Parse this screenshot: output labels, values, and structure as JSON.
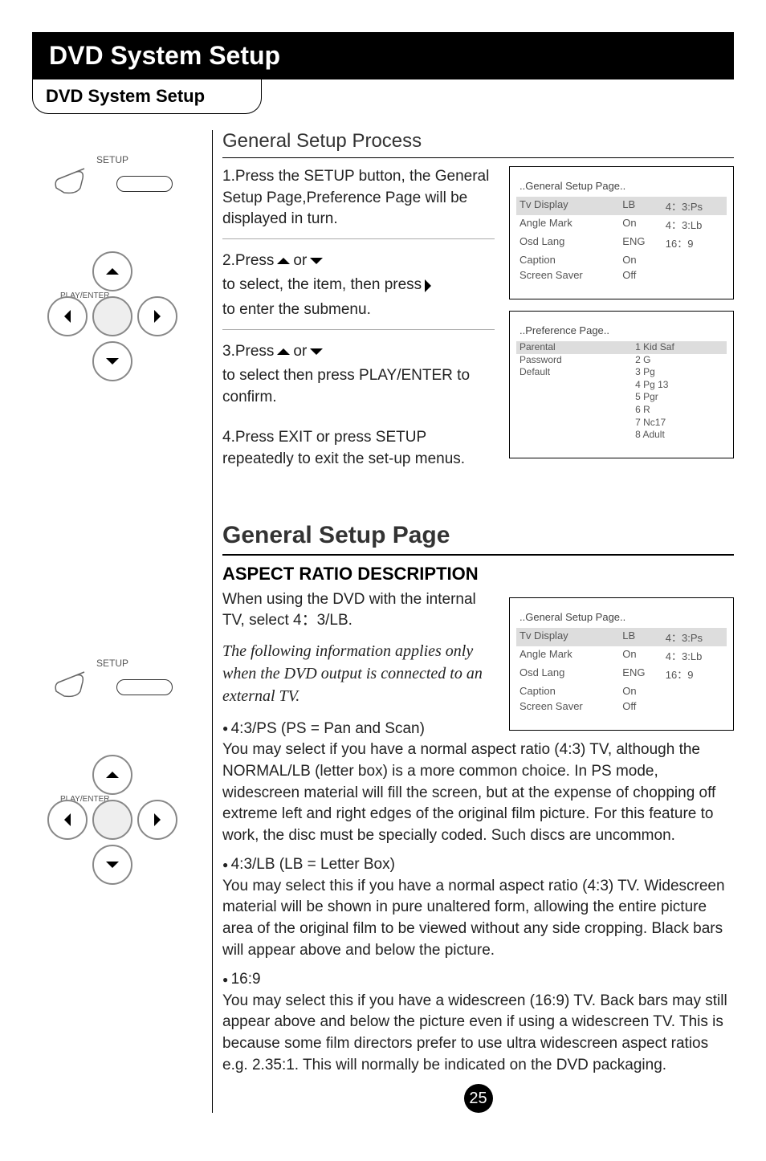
{
  "title_bar": "DVD System Setup",
  "subtitle": "DVD System Setup",
  "left": {
    "setup_label": "SETUP",
    "dpad_label": "PLAY/ENTER"
  },
  "process": {
    "heading": "General Setup Process",
    "step1": "1.Press the SETUP button, the General Setup Page,Preference Page  will be displayed in turn.",
    "step2a": "2.Press ",
    "step2b": " or ",
    "step2c": "   to select, the item, then press ",
    "step2d": " to enter the submenu.",
    "step3a": "3.Press ",
    "step3b": " or ",
    "step3c": "  to select  then press PLAY/ENTER to confirm.",
    "step4": "4.Press EXIT or press SETUP repeatedly to exit the set-up menus."
  },
  "osd1": {
    "title": "..General Setup Page..",
    "rows": [
      [
        "Tv Display",
        "LB",
        "4：3:Ps"
      ],
      [
        "Angle Mark",
        "On",
        "4：3:Lb"
      ],
      [
        "Osd Lang",
        "ENG",
        "16：9"
      ],
      [
        "Caption",
        "On",
        ""
      ],
      [
        "Screen Saver",
        "Off",
        ""
      ]
    ]
  },
  "osd2": {
    "title": "..Preference Page..",
    "left_items": [
      "Parental",
      "Password",
      "Default"
    ],
    "right_items": [
      "1 Kid Saf",
      "2 G",
      "3 Pg",
      "4 Pg 13",
      "5 Pgr",
      "6 R",
      "7 Nc17",
      "8 Adult"
    ]
  },
  "general_page": {
    "heading": "General Setup Page",
    "sub": "ASPECT RATIO DESCRIPTION",
    "intro": "When using the DVD with the internal TV, select 4：3/LB.",
    "note": "The following information applies only when the DVD output is connected to an external TV.",
    "ps": {
      "lbl": "4:3/PS (PS = Pan and Scan)",
      "txt": "You may select if you have a normal aspect ratio (4:3) TV, although the NORMAL/LB (letter box) is a more common choice. In PS mode, widescreen material will fill the screen, but at the expense of chopping off extreme left and right edges of the original film picture. For this feature to work, the disc must be specially coded. Such discs are uncommon."
    },
    "lb": {
      "lbl": "4:3/LB (LB = Letter Box)",
      "txt": "You may select this if you have a normal aspect ratio (4:3) TV. Widescreen material will be shown in pure unaltered form, allowing the entire picture area of the original film to be viewed without any side cropping. Black bars will appear above and below the picture."
    },
    "w169": {
      "lbl": "16:9",
      "txt": "You may select this if you have a widescreen (16:9) TV. Back bars may still appear above and below the picture even if using a widescreen TV. This is because some film directors prefer to use ultra widescreen aspect ratios e.g. 2.35:1. This will normally be indicated on the DVD packaging."
    }
  },
  "osd3": {
    "title": "..General Setup Page..",
    "rows": [
      [
        "Tv Display",
        "LB",
        "4：3:Ps"
      ],
      [
        "Angle Mark",
        "On",
        "4：3:Lb"
      ],
      [
        "Osd Lang",
        "ENG",
        "16：9"
      ],
      [
        "Caption",
        "On",
        ""
      ],
      [
        "Screen Saver",
        "Off",
        ""
      ]
    ]
  },
  "page_num": "25"
}
